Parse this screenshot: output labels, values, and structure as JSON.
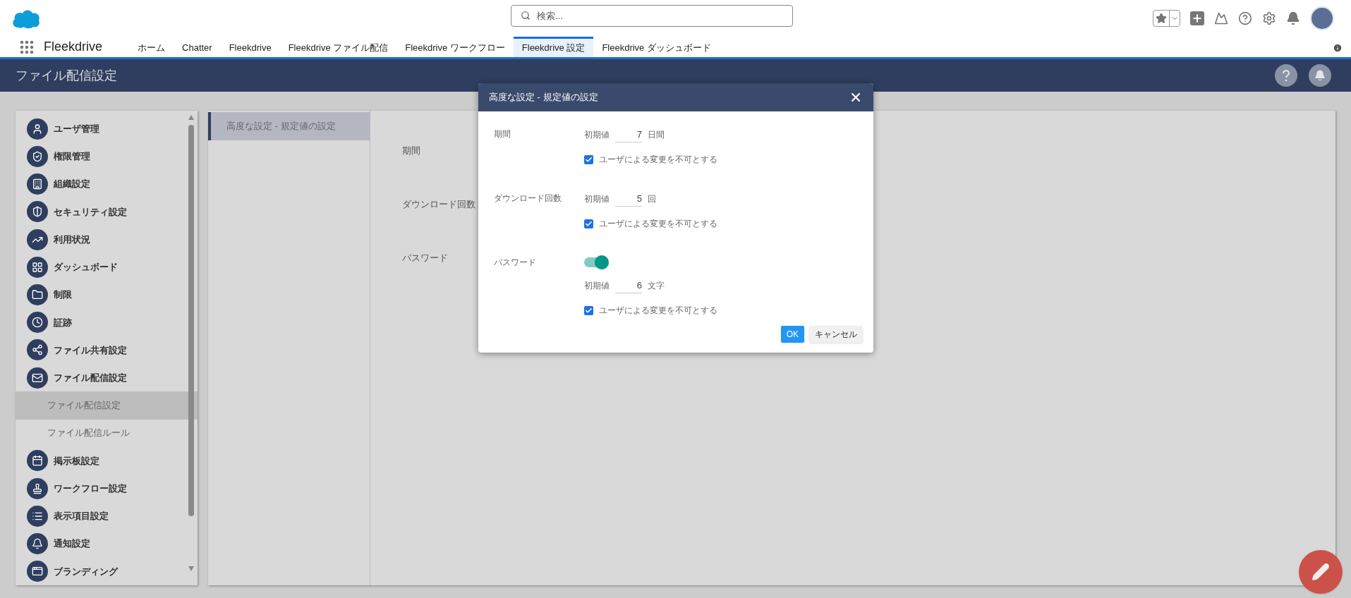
{
  "header": {
    "search": {
      "placeholder": "検索..."
    }
  },
  "nav": {
    "app_name": "Fleekdrive",
    "tabs": [
      {
        "label": "ホーム",
        "selected": false
      },
      {
        "label": "Chatter",
        "selected": false
      },
      {
        "label": "Fleekdrive",
        "selected": false
      },
      {
        "label": "Fleekdrive ファイル配信",
        "selected": false
      },
      {
        "label": "Fleekdrive ワークフロー",
        "selected": false
      },
      {
        "label": "Fleekdrive 設定",
        "selected": true
      },
      {
        "label": "Fleekdrive ダッシュボード",
        "selected": false
      }
    ]
  },
  "page_title": "ファイル配信設定",
  "sidebar": {
    "items": [
      {
        "kind": "section",
        "label": "ユーザ管理",
        "selected": false
      },
      {
        "kind": "section",
        "label": "権限管理",
        "selected": false
      },
      {
        "kind": "section",
        "label": "組織設定",
        "selected": false
      },
      {
        "kind": "section",
        "label": "セキュリティ設定",
        "selected": false
      },
      {
        "kind": "section",
        "label": "利用状況",
        "selected": false
      },
      {
        "kind": "section",
        "label": "ダッシュボード",
        "selected": false
      },
      {
        "kind": "section",
        "label": "制限",
        "selected": false
      },
      {
        "kind": "section",
        "label": "証跡",
        "selected": false
      },
      {
        "kind": "section",
        "label": "ファイル共有設定",
        "selected": false
      },
      {
        "kind": "section",
        "label": "ファイル配信設定",
        "selected": false
      },
      {
        "kind": "sub",
        "label": "ファイル配信設定",
        "selected": true
      },
      {
        "kind": "sub",
        "label": "ファイル配信ルール",
        "selected": false
      },
      {
        "kind": "section",
        "label": "掲示板設定",
        "selected": false
      },
      {
        "kind": "section",
        "label": "ワークフロー設定",
        "selected": false
      },
      {
        "kind": "section",
        "label": "表示項目設定",
        "selected": false
      },
      {
        "kind": "section",
        "label": "通知設定",
        "selected": false
      },
      {
        "kind": "section",
        "label": "ブランディング",
        "selected": false
      }
    ]
  },
  "subnav": {
    "items": [
      {
        "label": "高度な設定 - 規定値の設定",
        "selected": true
      }
    ]
  },
  "content": {
    "labels": [
      "期間",
      "ダウンロード回数",
      "パスワード"
    ]
  },
  "dialog": {
    "title": "高度な設定 - 規定値の設定",
    "sections": [
      {
        "label": "期間",
        "initial_label": "初期値",
        "value": "7",
        "unit": "日間",
        "lock": {
          "label": "ユーザによる変更を不可とする",
          "checked": true
        }
      },
      {
        "label": "ダウンロード回数",
        "initial_label": "初期値",
        "value": "5",
        "unit": "回",
        "lock": {
          "label": "ユーザによる変更を不可とする",
          "checked": true
        }
      },
      {
        "label": "パスワード",
        "toggle": {
          "on": true
        },
        "initial_label": "初期値",
        "value": "6",
        "unit": "文字",
        "lock": {
          "label": "ユーザによる変更を不可とする",
          "checked": true
        }
      }
    ],
    "buttons": [
      {
        "kind": "primary",
        "label": "OK"
      },
      {
        "kind": "secondary",
        "label": "キャンセル"
      }
    ]
  }
}
